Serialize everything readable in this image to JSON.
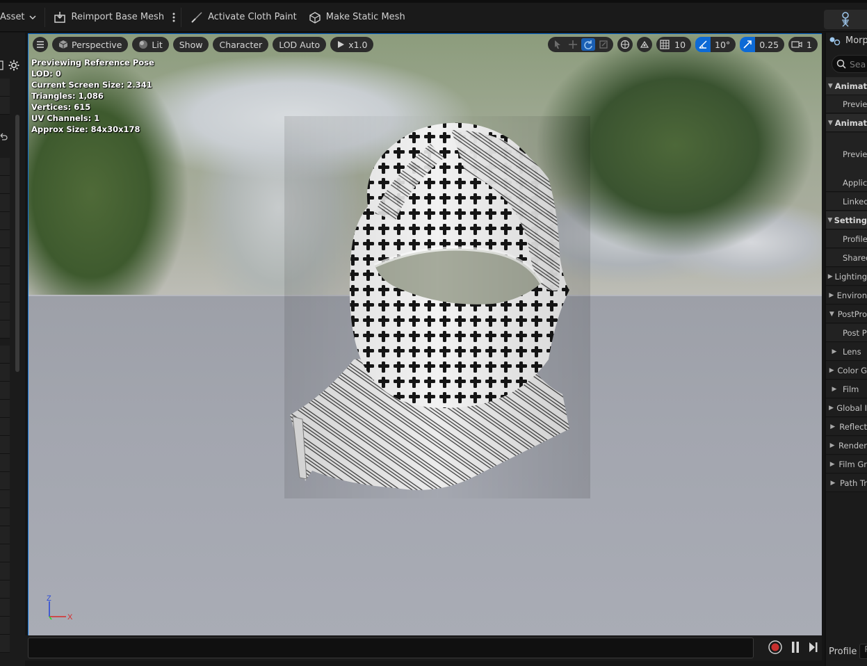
{
  "toolbar": {
    "asset_label": "Asset",
    "reimport_label": "Reimport Base Mesh",
    "cloth_paint_label": "Activate Cloth Paint",
    "static_mesh_label": "Make Static Mesh"
  },
  "viewport": {
    "perspective_label": "Perspective",
    "lit_label": "Lit",
    "show_label": "Show",
    "character_label": "Character",
    "lod_label": "LOD Auto",
    "playback_speed": "x1.0",
    "grid_snap": "10",
    "rotation_snap": "10°",
    "scale_snap": "0.25",
    "camera_speed": "1"
  },
  "stats": {
    "line1": "Previewing Reference Pose",
    "line2": "LOD: 0",
    "line3": "Current Screen Size: 2.341",
    "line4": "Triangles: 1,086",
    "line5": "Vertices: 615",
    "line6": "UV Channels: 1",
    "line7": "Approx Size: 84x30x178"
  },
  "axis": {
    "z": "Z",
    "x": "X"
  },
  "right_panel": {
    "title": "Morph",
    "search_placeholder": "Sea",
    "rows": [
      {
        "label": "Animat",
        "kind": "section"
      },
      {
        "label": "Preview",
        "kind": "item"
      },
      {
        "label": "Animat",
        "kind": "section"
      },
      {
        "label": "Preview",
        "kind": "item"
      },
      {
        "label": "Applica",
        "kind": "item"
      },
      {
        "label": "Linked",
        "kind": "item"
      },
      {
        "label": "Setting",
        "kind": "section"
      },
      {
        "label": "Profile",
        "kind": "item"
      },
      {
        "label": "Shared",
        "kind": "item"
      },
      {
        "label": "Lighting",
        "kind": "collapsed"
      },
      {
        "label": "Environ",
        "kind": "collapsed"
      },
      {
        "label": "PostPro",
        "kind": "expanded"
      },
      {
        "label": "Post Pr",
        "kind": "item"
      },
      {
        "label": "Lens",
        "kind": "collapsed"
      },
      {
        "label": "Color G",
        "kind": "collapsed"
      },
      {
        "label": "Film",
        "kind": "collapsed"
      },
      {
        "label": "Global I",
        "kind": "collapsed"
      },
      {
        "label": "Reflect",
        "kind": "collapsed"
      },
      {
        "label": "Render",
        "kind": "collapsed"
      },
      {
        "label": "Film Gr",
        "kind": "collapsed"
      },
      {
        "label": "Path Tr",
        "kind": "collapsed"
      }
    ],
    "profile_label": "Profile",
    "profile_value": "Pr"
  },
  "colors": {
    "accent": "#0d6ad6",
    "record": "#c8302e"
  }
}
